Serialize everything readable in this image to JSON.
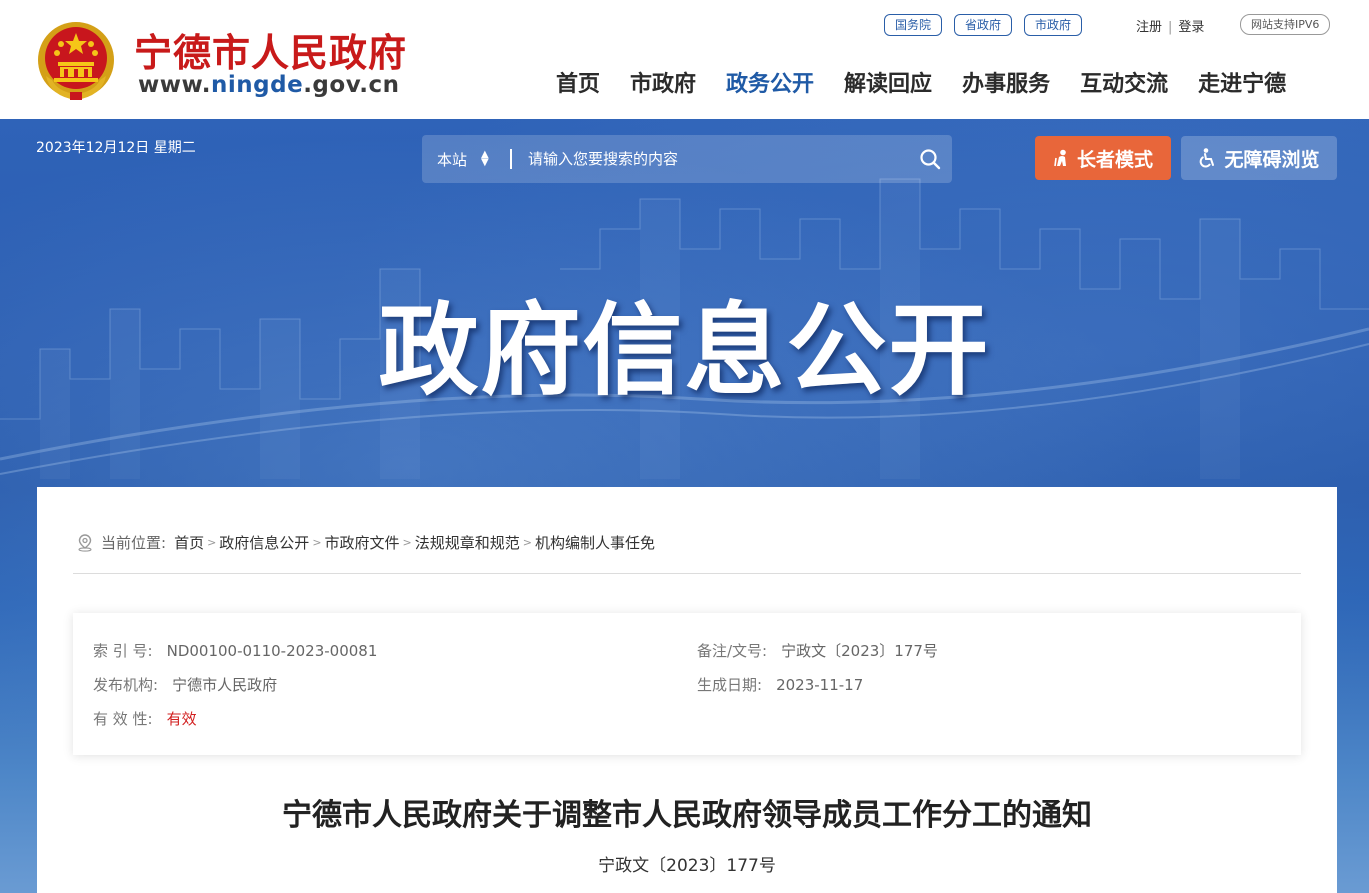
{
  "header": {
    "site_name": "宁德市人民政府",
    "url_prefix": "www.",
    "url_mid": "ningde",
    "url_suffix": ".gov.cn",
    "top_links": [
      "国务院",
      "省政府",
      "市政府"
    ],
    "register": "注册",
    "login": "登录",
    "ipv6_badge": "网站支持IPV6",
    "nav": [
      {
        "label": "首页",
        "active": false
      },
      {
        "label": "市政府",
        "active": false
      },
      {
        "label": "政务公开",
        "active": true
      },
      {
        "label": "解读回应",
        "active": false
      },
      {
        "label": "办事服务",
        "active": false
      },
      {
        "label": "互动交流",
        "active": false
      },
      {
        "label": "走进宁德",
        "active": false
      }
    ]
  },
  "banner": {
    "date": "2023年12月12日 星期二",
    "search_scope": "本站",
    "search_placeholder": "请输入您要搜索的内容",
    "elder_mode": "长者模式",
    "accessible": "无障碍浏览",
    "hero_title": "政府信息公开"
  },
  "breadcrumb": {
    "lead": "当前位置:",
    "items": [
      "首页",
      "政府信息公开",
      "市政府文件",
      "法规规章和规范",
      "机构编制人事任免"
    ]
  },
  "meta": {
    "index_label": "索 引 号:",
    "index_value": "ND00100-0110-2023-00081",
    "doc_label": "备注/文号:",
    "doc_value": "宁政文〔2023〕177号",
    "publisher_label": "发布机构:",
    "publisher_value": "宁德市人民政府",
    "date_label": "生成日期:",
    "date_value": "2023-11-17",
    "validity_label": "有 效 性:",
    "validity_value": "有效"
  },
  "document": {
    "title": "宁德市人民政府关于调整市人民政府领导成员工作分工的通知",
    "number": "宁政文〔2023〕177号"
  },
  "colors": {
    "brand_red": "#c81a1a",
    "nav_active": "#1f5aa6",
    "banner_blue": "#2a5cb0",
    "elder_orange": "#e8663a",
    "validity_red": "#d21f1f"
  }
}
